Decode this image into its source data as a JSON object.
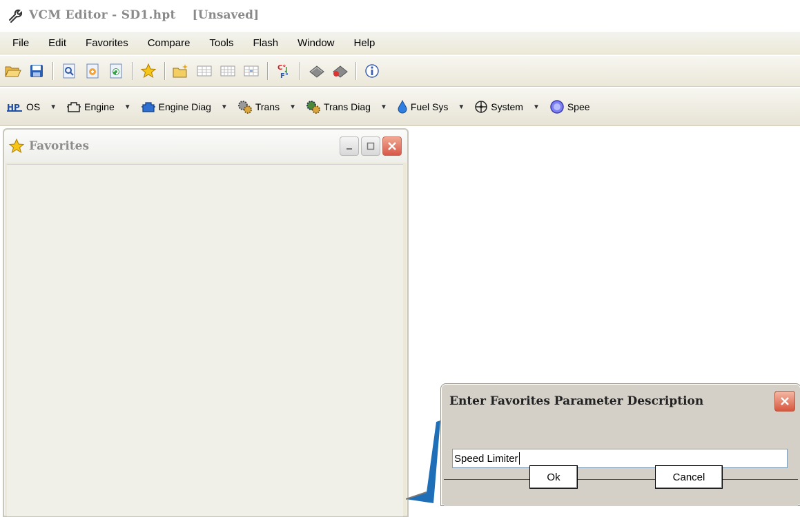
{
  "window": {
    "app_title": "VCM Editor - SD1.hpt",
    "status": "[Unsaved]",
    "app_icon": "wrench-icon"
  },
  "menu": [
    "File",
    "Edit",
    "Favorites",
    "Compare",
    "Tools",
    "Flash",
    "Window",
    "Help"
  ],
  "toolbar": {
    "buttons": [
      "open-folder-icon",
      "save-icon",
      "document-search-icon",
      "document-arrow-icon",
      "document-refresh-icon",
      "favorites-star-icon",
      "new-folder-icon",
      "grid-icon",
      "grid-plus-icon",
      "grid-compare-icon",
      "convert-cf-icon",
      "chip-read-icon",
      "chip-write-icon",
      "info-icon"
    ]
  },
  "categories": [
    {
      "label": "OS",
      "icon": "hp-logo-icon"
    },
    {
      "label": "Engine",
      "icon": "engine-icon"
    },
    {
      "label": "Engine Diag",
      "icon": "engine-diag-icon"
    },
    {
      "label": "Trans",
      "icon": "gears-icon"
    },
    {
      "label": "Trans Diag",
      "icon": "gears-diag-icon"
    },
    {
      "label": "Fuel Sys",
      "icon": "fuel-drop-icon"
    },
    {
      "label": "System",
      "icon": "system-fan-icon"
    },
    {
      "label": "Spee",
      "icon": "speedometer-icon"
    }
  ],
  "favorites_window": {
    "title": "Favorites",
    "icon": "star-icon"
  },
  "dialog": {
    "title": "Enter Favorites Parameter Description",
    "input_value": "Speed Limiter",
    "ok_label": "Ok",
    "cancel_label": "Cancel"
  },
  "colors": {
    "chrome": "#ece9d8",
    "close_red": "#d7573f",
    "callout_blue": "#1f6fb8"
  }
}
